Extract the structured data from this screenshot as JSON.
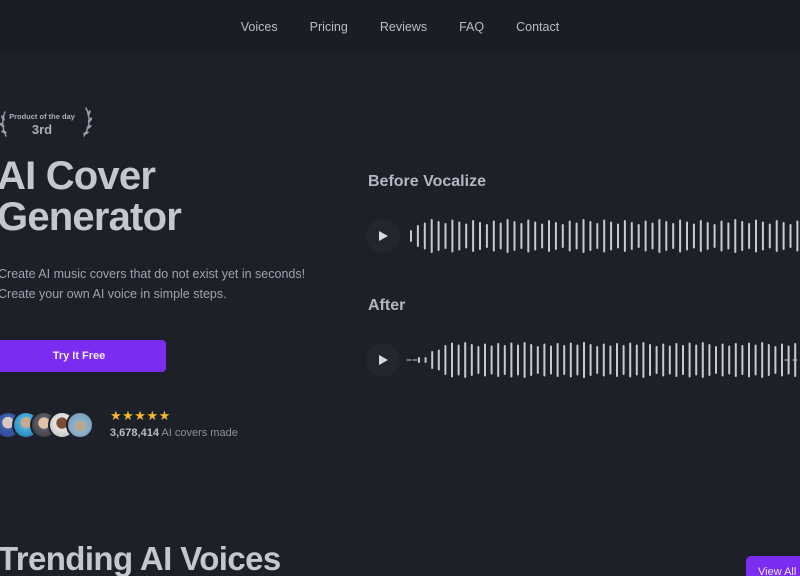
{
  "nav": {
    "items": [
      "Voices",
      "Pricing",
      "Reviews",
      "FAQ",
      "Contact"
    ]
  },
  "badge": {
    "top": "Product of the day",
    "rank": "3rd"
  },
  "hero": {
    "title_line1": "AI Cover",
    "title_line2": "Generator",
    "sub_line1": "Create AI music covers that do not exist yet in seconds!",
    "sub_line2": "Create your own AI voice in simple steps.",
    "cta": "Try It Free"
  },
  "social": {
    "stars": "★★★★★",
    "count": "3,678,414",
    "count_suffix": " AI covers made"
  },
  "audio": {
    "before_label": "Before Vocalize",
    "after_label": "After"
  },
  "trending": {
    "title": "Trending AI Voices",
    "view_all": "View All"
  },
  "colors": {
    "background": "#1d2028",
    "accent": "#7b2cf0",
    "star": "#f5b92b"
  }
}
